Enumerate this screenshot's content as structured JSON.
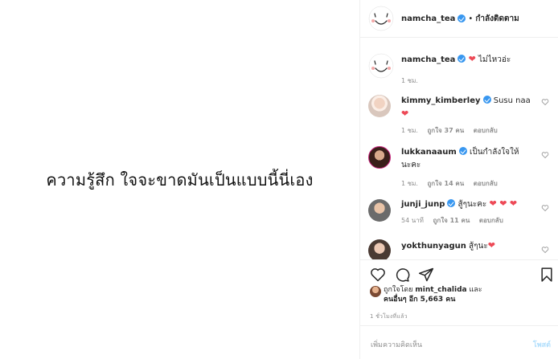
{
  "image": {
    "caption": "ความรู้สึก ใจจะขาดมันเป็นแบบนี้นี่เอง"
  },
  "header": {
    "username": "namcha_tea",
    "separator": "•",
    "follow_state": "กำลังติดตาม"
  },
  "comments": [
    {
      "username": "namcha_tea",
      "verified": true,
      "text": "ไม่ไหวอ่ะ",
      "hearts_before": 1,
      "hearts_after": 0,
      "time": "1 ชม.",
      "likes": "",
      "reply": ""
    },
    {
      "username": "kimmy_kimberley",
      "verified": true,
      "text": "Susu naa",
      "hearts_before": 0,
      "hearts_after": 1,
      "time": "1 ชม.",
      "likes": "ถูกใจ 37 คน",
      "reply": "ตอบกลับ"
    },
    {
      "username": "lukkanaaum",
      "verified": true,
      "text": "เป็นกำลังใจให้นะคะ",
      "hearts_before": 0,
      "hearts_after": 0,
      "time": "1 ชม.",
      "likes": "ถูกใจ 14 คน",
      "reply": "ตอบกลับ"
    },
    {
      "username": "junji_junp",
      "verified": true,
      "text": "สู้ๆนะคะ",
      "hearts_before": 0,
      "hearts_after": 3,
      "time": "54 นาที",
      "likes": "ถูกใจ 11 คน",
      "reply": "ตอบกลับ"
    },
    {
      "username": "yokthunyagun",
      "verified": false,
      "text": "สู้ๆนะ",
      "hearts_before": 0,
      "hearts_after": 1,
      "time": "",
      "likes": "",
      "reply": ""
    }
  ],
  "liked_by": {
    "prefix": "ถูกใจโดย",
    "user": "mint_chalida",
    "and": "และ",
    "others": "คนอื่นๆ อีก 5,663 คน"
  },
  "time_ago": "1 ชั่วโมงที่แล้ว",
  "add_comment": {
    "placeholder": "เพิ่มความคิดเห็น",
    "post_label": "โพสต์"
  },
  "colors": {
    "heart": "#ed4956",
    "verified": "#3897f0",
    "muted": "#8e8e8e",
    "post_disabled": "#b2dffc"
  }
}
